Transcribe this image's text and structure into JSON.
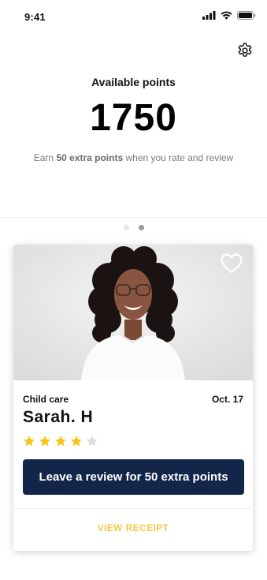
{
  "status_bar": {
    "time": "9:41",
    "icons": [
      "signal-icon",
      "wifi-icon",
      "battery-icon"
    ]
  },
  "header": {
    "settings_icon": "gear-icon"
  },
  "points": {
    "label": "Available points",
    "value": "1750",
    "earn_prefix": "Earn ",
    "earn_bold": "50 extra points",
    "earn_suffix": " when you rate and review"
  },
  "carousel": {
    "total": 2,
    "active_index": 1
  },
  "card": {
    "category": "Child care",
    "date": "Oct. 17",
    "name": "Sarah. H",
    "rating": 4,
    "rating_max": 5,
    "favorite_icon": "heart-outline-icon",
    "review_button": "Leave a review for 50 extra points",
    "receipt_link": "VIEW RECEIPT"
  },
  "colors": {
    "primary_button": "#13264a",
    "accent": "#f2c94c",
    "star_filled": "#f5c518",
    "star_empty": "#dcdcdc",
    "muted_text": "#7a7a7a"
  }
}
